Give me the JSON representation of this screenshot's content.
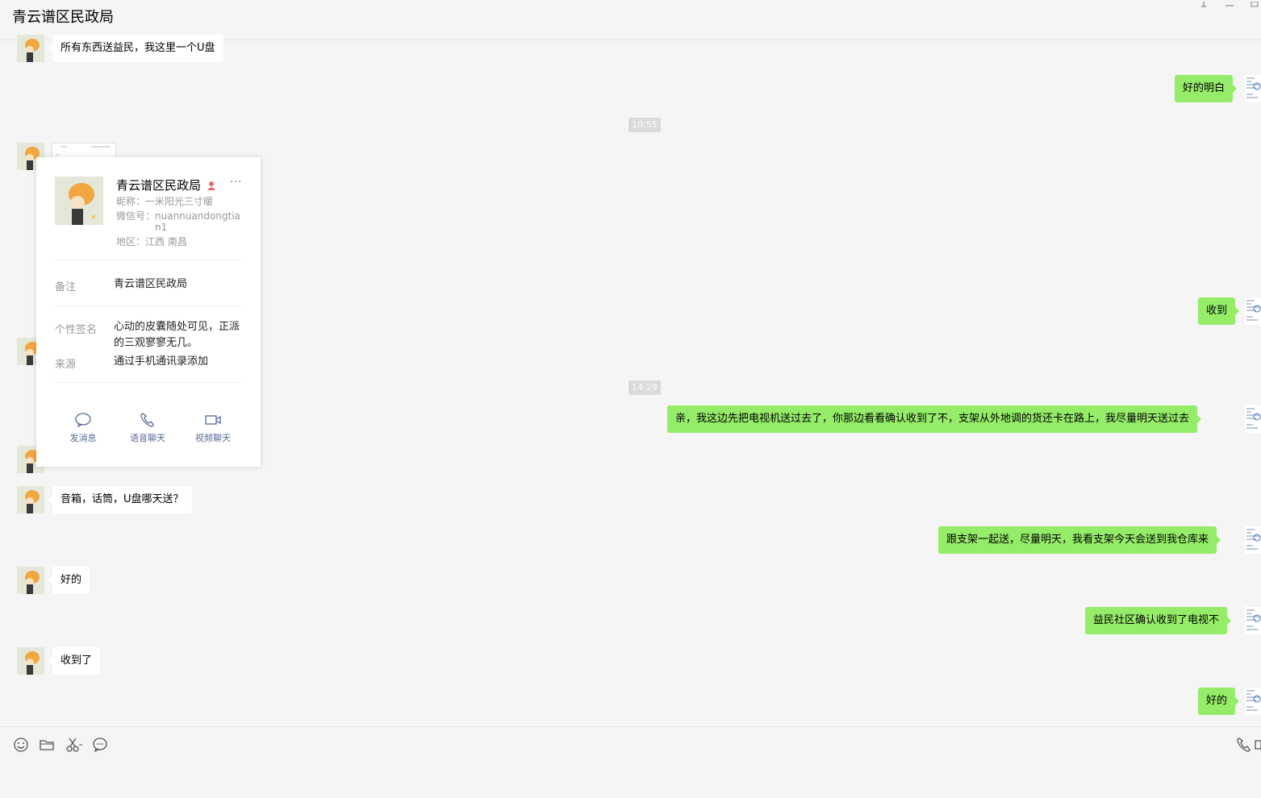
{
  "window": {
    "title": "青云谱区民政局"
  },
  "messages": {
    "m1": "所有东西送益民，我这里一个U盘",
    "m2": "好的明白",
    "t1": "10:55",
    "m3": "收到",
    "t2": "14:29",
    "m4": "亲，我这边先把电视机送过去了，你那边看看确认收到了不，支架从外地调的货还卡在路上，我尽量明天送过去",
    "m5": "音箱，话筒，U盘哪天送？",
    "m6": "跟支架一起送，尽量明天，我看支架今天会送到我仓库来",
    "m7": "好的",
    "m8": "益民社区确认收到了电视不",
    "m9": "收到了",
    "m10": "好的"
  },
  "card": {
    "name": "青云谱区民政局",
    "more": "···",
    "nickname": "昵称：一米阳光三寸暖",
    "wechat_id_line1": "微信号：nuannuandongtia",
    "wechat_id_line2": "n1",
    "region": "地区：江西 南昌",
    "remark_label": "备注",
    "remark_value": "青云谱区民政局",
    "signature_label": "个性签名",
    "signature_value": "心动的皮囊随处可见，正派的三观寥寥无几。",
    "source_label": "来源",
    "source_value": "通过手机通讯录添加",
    "actions": {
      "message": "发消息",
      "voice": "语音聊天",
      "video": "视频聊天"
    }
  },
  "colors": {
    "sent_bubble": "#95ec69",
    "received_bubble": "#ffffff",
    "background": "#f5f5f5",
    "link_blue": "#576b95"
  }
}
